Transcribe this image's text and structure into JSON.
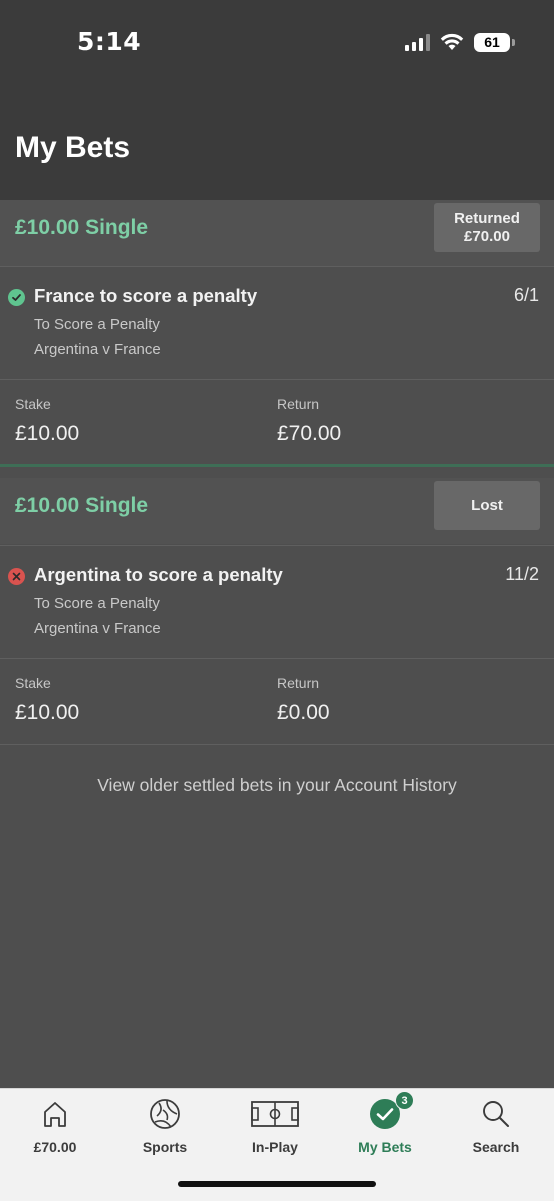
{
  "status_bar": {
    "time": "5:14",
    "battery": "61"
  },
  "header": {
    "title": "My Bets"
  },
  "bets": [
    {
      "type": "£10.00 Single",
      "status_line1": "Returned",
      "status_line2": "£70.00",
      "result": "won",
      "selection": "France to score a penalty",
      "odds": "6/1",
      "market": "To Score a Penalty",
      "event": "Argentina v France",
      "stake_label": "Stake",
      "stake": "£10.00",
      "return_label": "Return",
      "return": "£70.00"
    },
    {
      "type": "£10.00 Single",
      "status_line1": "Lost",
      "result": "lost",
      "selection": "Argentina to score a penalty",
      "odds": "11/2",
      "market": "To Score a Penalty",
      "event": "Argentina v France",
      "stake_label": "Stake",
      "stake": "£10.00",
      "return_label": "Return",
      "return": "£0.00"
    }
  ],
  "history_link": "View older settled bets in your Account History",
  "nav": {
    "items": [
      {
        "label": "£70.00",
        "icon": "home-icon"
      },
      {
        "label": "Sports",
        "icon": "football-icon"
      },
      {
        "label": "In-Play",
        "icon": "pitch-icon"
      },
      {
        "label": "My Bets",
        "icon": "checkmark-icon",
        "badge": "3",
        "active": true
      },
      {
        "label": "Search",
        "icon": "search-icon"
      }
    ]
  },
  "colors": {
    "accent_green": "#7ecfa6",
    "active_nav": "#2e7d57",
    "won_icon": "#5fc48f",
    "lost_icon": "#d9534f"
  }
}
